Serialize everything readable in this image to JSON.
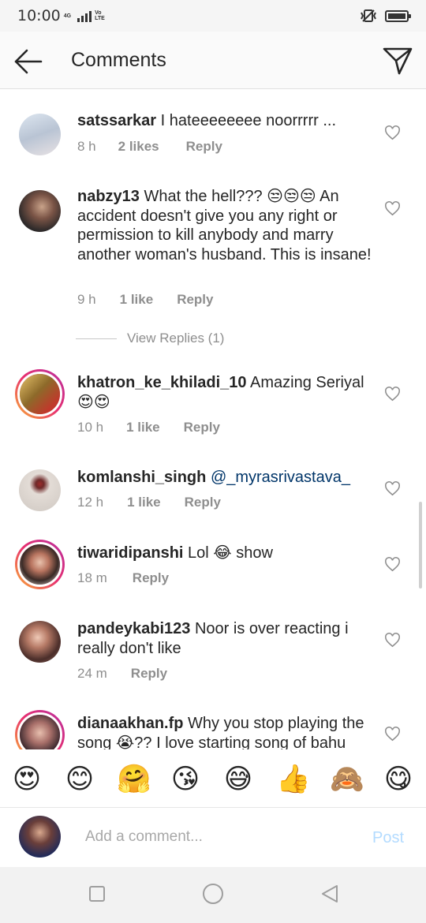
{
  "status": {
    "time": "10:00",
    "net": "4G",
    "volte": "Vo LTE"
  },
  "header": {
    "title": "Comments"
  },
  "comments": [
    {
      "user": "satssarkar",
      "text": "I hateeeeeeee noorrrrr ...",
      "time": "8 h",
      "likes": "2 likes",
      "reply": "Reply",
      "avatar": "#c9d7e8"
    },
    {
      "user": "nabzy13",
      "text": "What the hell??? 😒😒😒 An accident doesn't give you any right or permission to kill anybody and marry another woman's husband. This is insane!",
      "time": "9 h",
      "likes": "1 like",
      "reply": "Reply",
      "avatar": "#5a4a3e"
    },
    {
      "user": "khatron_ke_khiladi_10",
      "text": "Amazing Seriyal 😍😍",
      "time": "10 h",
      "likes": "1 like",
      "reply": "Reply",
      "avatar": "#b8952f"
    },
    {
      "user": "komlanshi_singh",
      "text": "@_myrasrivastava_",
      "time": "12 h",
      "likes": "1 like",
      "reply": "Reply",
      "avatar": "#d8d3cf"
    },
    {
      "user": "tiwaridipanshi",
      "text": "Lol 😂 show",
      "time": "18 m",
      "likes": "",
      "reply": "Reply",
      "avatar": "#c98a78"
    },
    {
      "user": "pandeykabi123",
      "text": "Noor is over reacting i really don't like",
      "time": "24 m",
      "likes": "",
      "reply": "Reply",
      "avatar": "#6b4b43"
    },
    {
      "user": "dianaakhan.fp",
      "text": "Why you stop playing the song 😭?? I love starting song of bahu",
      "time": "",
      "likes": "",
      "reply": "",
      "avatar": "#7a5a66"
    }
  ],
  "view_replies": "View Replies (1)",
  "emojis": [
    "😍",
    "😊",
    "🤗",
    "😘",
    "😅",
    "👍",
    "🙈",
    "😋"
  ],
  "input": {
    "placeholder": "Add a comment...",
    "post_label": "Post"
  }
}
